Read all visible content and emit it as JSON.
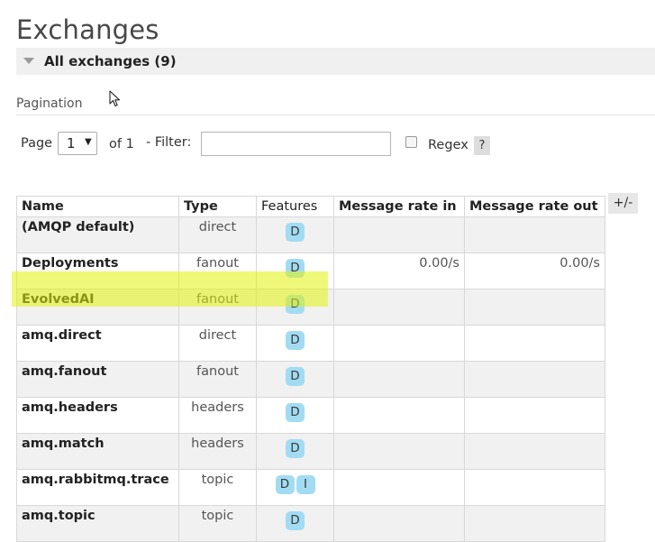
{
  "page": {
    "title": "Exchanges"
  },
  "section": {
    "title": "All exchanges (9)"
  },
  "pagination": {
    "label": "Pagination",
    "page_label": "Page",
    "page_value": "1",
    "of_label": "of 1",
    "filter_label": "- Filter:",
    "filter_value": "",
    "regex_label": "Regex",
    "help_label": "?"
  },
  "table": {
    "columns": [
      "Name",
      "Type",
      "Features",
      "Message rate in",
      "Message rate out"
    ],
    "toggle_label": "+/-",
    "rows": [
      {
        "name": "(AMQP default)",
        "type": "direct",
        "features": [
          "D"
        ],
        "rate_in": "",
        "rate_out": ""
      },
      {
        "name": "Deployments",
        "type": "fanout",
        "features": [
          "D"
        ],
        "rate_in": "0.00/s",
        "rate_out": "0.00/s"
      },
      {
        "name": "EvolvedAI",
        "type": "fanout",
        "features": [
          "D"
        ],
        "rate_in": "",
        "rate_out": ""
      },
      {
        "name": "amq.direct",
        "type": "direct",
        "features": [
          "D"
        ],
        "rate_in": "",
        "rate_out": ""
      },
      {
        "name": "amq.fanout",
        "type": "fanout",
        "features": [
          "D"
        ],
        "rate_in": "",
        "rate_out": ""
      },
      {
        "name": "amq.headers",
        "type": "headers",
        "features": [
          "D"
        ],
        "rate_in": "",
        "rate_out": ""
      },
      {
        "name": "amq.match",
        "type": "headers",
        "features": [
          "D"
        ],
        "rate_in": "",
        "rate_out": ""
      },
      {
        "name": "amq.rabbitmq.trace",
        "type": "topic",
        "features": [
          "D",
          "I"
        ],
        "rate_in": "",
        "rate_out": ""
      },
      {
        "name": "amq.topic",
        "type": "topic",
        "features": [
          "D"
        ],
        "rate_in": "",
        "rate_out": ""
      }
    ]
  },
  "colors": {
    "badge": "#a2dcf2",
    "highlight": "#e2f30b"
  }
}
